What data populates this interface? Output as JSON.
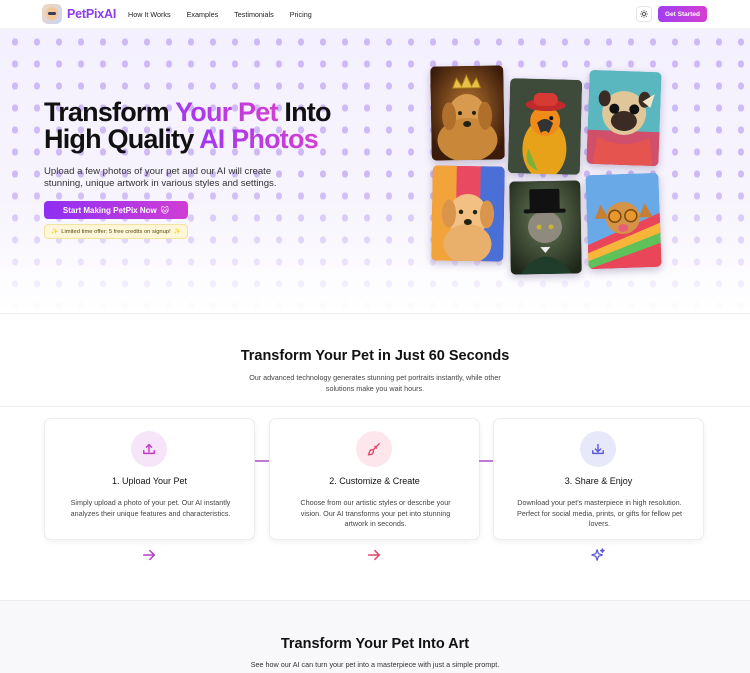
{
  "brand": {
    "name": "PetPixAI"
  },
  "nav": {
    "links": [
      "How It Works",
      "Examples",
      "Testimonials",
      "Pricing"
    ],
    "theme_icon": "sun-icon",
    "cta_label": "Get Started"
  },
  "hero": {
    "title_line1_a": "Transform ",
    "title_line1_b": "Your Pet",
    "title_line1_c": " Into",
    "title_line2_a": "High Quality ",
    "title_line2_b": "AI Photos",
    "subtitle": "Upload a few photos of your pet and our AI will create stunning, unique artwork in various styles and settings.",
    "cta_label": "Start Making PetPix Now",
    "cta_emoji": "🐱",
    "offer_text": "Limited time offer: 5 free credits on signup!",
    "offer_emoji": "✨",
    "gallery": [
      {
        "name": "golden-retriever-crown",
        "alt": "dog with crown"
      },
      {
        "name": "parrot-hat",
        "alt": "parrot in hat"
      },
      {
        "name": "pug-scarf",
        "alt": "pug with scarf"
      },
      {
        "name": "puppy-colorful",
        "alt": "colorful puppy"
      },
      {
        "name": "cat-top-hat",
        "alt": "cat in top hat"
      },
      {
        "name": "dog-sunglasses",
        "alt": "dog with sunglasses"
      }
    ]
  },
  "how": {
    "title": "Transform Your Pet in Just 60 Seconds",
    "subtitle": "Our advanced technology generates stunning pet portraits instantly, while other solutions make you wait hours.",
    "steps": [
      {
        "title": "1. Upload Your Pet",
        "desc": "Simply upload a photo of your pet. Our AI instantly analyzes their unique features and characteristics.",
        "icon": "upload-icon",
        "color": "#c236c8",
        "bg": "#f6e5f8"
      },
      {
        "title": "2. Customize & Create",
        "desc": "Choose from our artistic styles or describe your vision. Our AI transforms your pet into stunning artwork in seconds.",
        "icon": "paintbrush-icon",
        "color": "#e0456a",
        "bg": "#fde6ec"
      },
      {
        "title": "3. Share & Enjoy",
        "desc": "Download your pet's masterpiece in high resolution. Perfect for social media, prints, or gifts for fellow pet lovers.",
        "icon": "download-icon",
        "color": "#5b58d8",
        "bg": "#e8e8fb"
      }
    ]
  },
  "art": {
    "title": "Transform Your Pet Into Art",
    "subtitle": "See how our AI can turn your pet into a masterpiece with just a simple prompt."
  }
}
